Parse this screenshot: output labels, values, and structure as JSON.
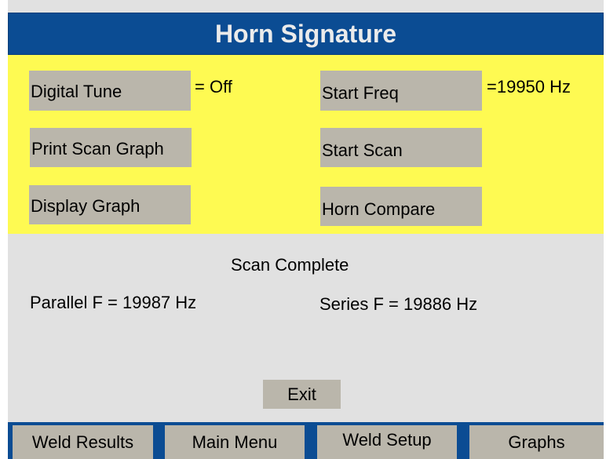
{
  "title": "Horn Signature",
  "buttons": {
    "digital_tune": "Digital Tune",
    "start_freq": "Start Freq",
    "print_scan_graph": "Print Scan Graph",
    "start_scan": "Start Scan",
    "display_graph": "Display Graph",
    "horn_compare": "Horn Compare"
  },
  "values": {
    "digital_tune": "= Off",
    "start_freq": "=19950 Hz"
  },
  "status": {
    "scan_complete": "Scan Complete",
    "parallel": "Parallel F = 19987 Hz",
    "series": "Series F = 19886 Hz"
  },
  "exit_label": "Exit",
  "tabs": [
    "Weld Results",
    "Main Menu",
    "Weld Setup",
    "Graphs"
  ],
  "colors": {
    "title_bar": "#0b4c93",
    "panel": "#fefa52",
    "button": "#bab6ab",
    "background": "#e1e1e1"
  }
}
